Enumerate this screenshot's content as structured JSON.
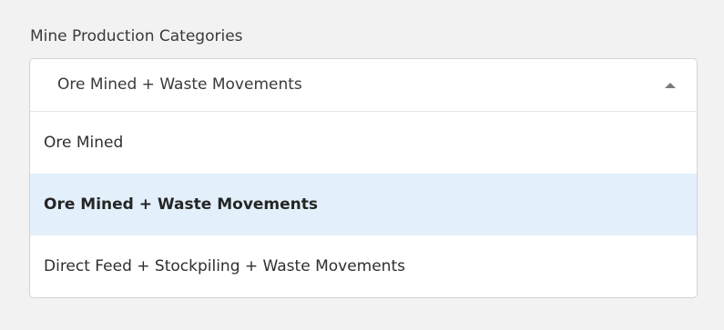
{
  "dropdown": {
    "label": "Mine Production Categories",
    "selected": "Ore Mined + Waste Movements",
    "icon": "chevron-up-icon",
    "options": [
      {
        "label": "Ore Mined",
        "selected": false
      },
      {
        "label": "Ore Mined + Waste Movements",
        "selected": true
      },
      {
        "label": "Direct Feed + Stockpiling + Waste Movements",
        "selected": false
      }
    ]
  },
  "colors": {
    "background": "#f2f2f2",
    "dropdown_bg": "#ffffff",
    "selected_option_bg": "#e3f0fb",
    "border": "#cfd4d9"
  }
}
